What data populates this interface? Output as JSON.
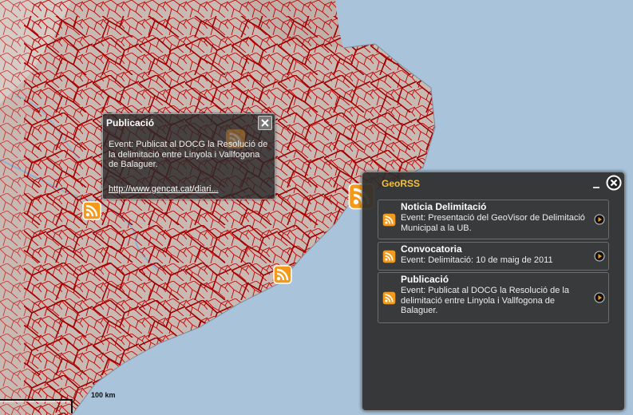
{
  "map": {
    "scale_label": "100 km",
    "colors": {
      "sea": "#a9c3da",
      "land": "#c9b9b3",
      "border": "#c00000"
    }
  },
  "popup": {
    "title": "Publicació",
    "body": "Event: Publicat al DOCG la Resolució de la delimitació entre Linyola i Vallfogona de Balaguer.",
    "link": "http://www.gencat.cat/diari..."
  },
  "panel": {
    "title": "GeoRSS",
    "items": [
      {
        "title": "Noticia Delimitació",
        "desc": "Event: Presentació del GeoVisor de Delimitació Municipal a la UB."
      },
      {
        "title": "Convocatoria",
        "desc": "Event: Delimitació: 10 de maig de 2011"
      },
      {
        "title": "Publicació",
        "desc": "Event: Publicat al DOCG la Resolució de la delimitació entre Linyola i Vallfogona de Balaguer."
      }
    ]
  },
  "icons": {
    "marker": "rss-feed-icon",
    "close": "close-icon",
    "minimize": "minimize-icon",
    "arrow": "play-arrow-icon"
  }
}
